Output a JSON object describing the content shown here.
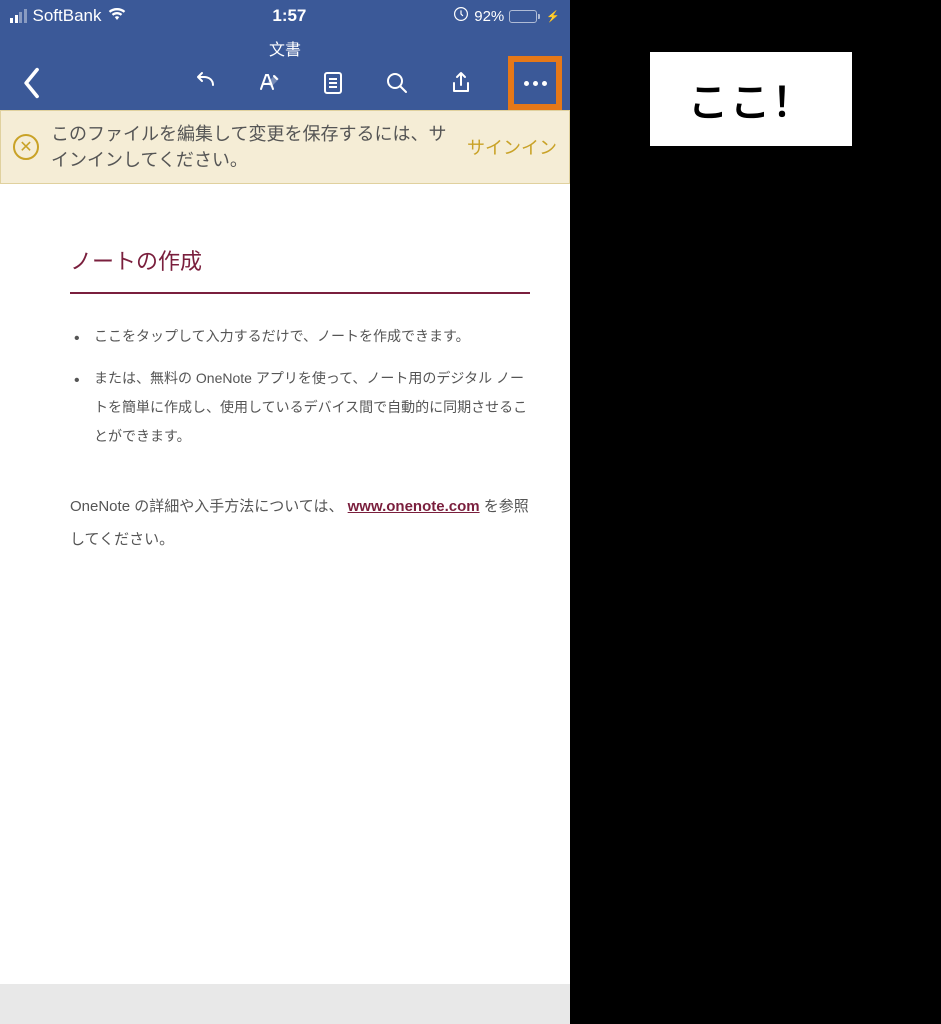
{
  "statusBar": {
    "carrier": "SoftBank",
    "time": "1:57",
    "battery": "92%"
  },
  "header": {
    "title": "文書"
  },
  "banner": {
    "message": "このファイルを編集して変更を保存するには、サインインしてください。",
    "action": "サインイン"
  },
  "document": {
    "heading": "ノートの作成",
    "bullets": [
      "ここをタップして入力するだけで、ノートを作成できます。",
      "または、無料の OneNote アプリを使って、ノート用のデジタル ノートを簡単に作成し、使用しているデバイス間で自動的に同期させることができます。"
    ],
    "paraBefore": "OneNote の詳細や入手方法については、",
    "link": "www.onenote.com",
    "paraAfter": " を参照してください。"
  },
  "callout": {
    "text": "ここ！"
  }
}
